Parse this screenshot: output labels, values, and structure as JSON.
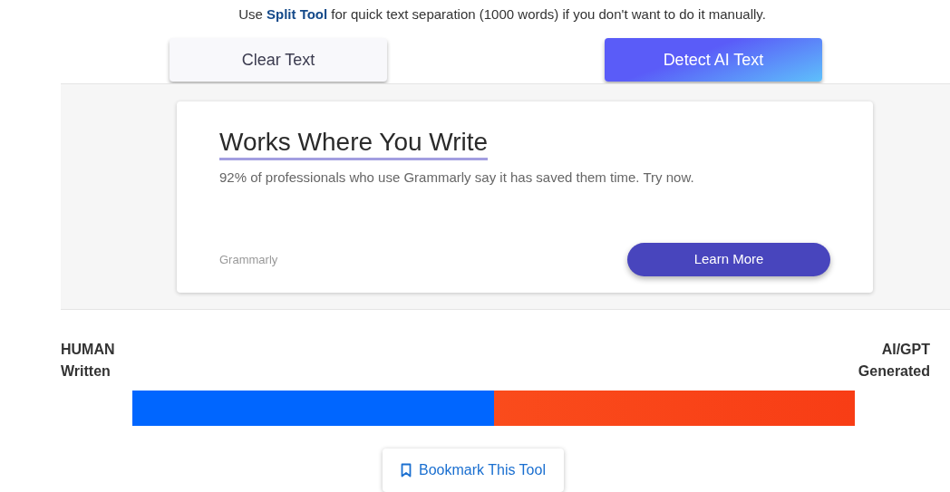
{
  "intro": {
    "before": "Use ",
    "link": "Split Tool",
    "after": " for quick text separation (1000 words) if you don't want to do it manually."
  },
  "buttons": [
    {
      "label": "Clear Text",
      "kind": "plain"
    },
    {
      "label": "Detect AI Text",
      "kind": "primary"
    }
  ],
  "ad": {
    "title": "Works Where You Write",
    "text": "92% of professionals who use Grammarly say it has saved them time. Try now.",
    "brand": "Grammarly",
    "cta": "Learn More"
  },
  "meter": {
    "left_label": [
      "HUMAN",
      "Written"
    ],
    "right_label": [
      "AI/GPT",
      "Generated"
    ],
    "level": 0.5
  },
  "bookmark": {
    "label": "Bookmark This Tool"
  }
}
